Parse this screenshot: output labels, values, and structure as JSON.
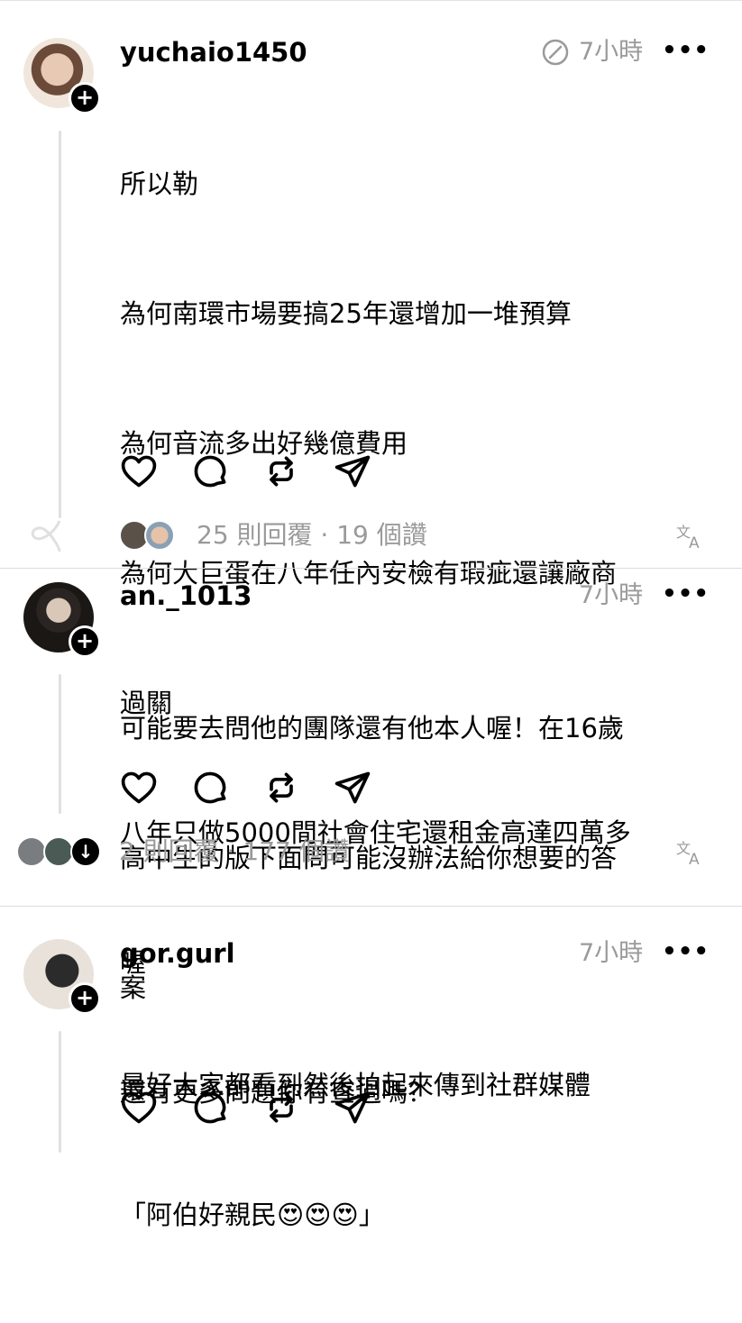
{
  "posts": [
    {
      "username": "yuchaio1450",
      "time": "7小時",
      "lines": [
        "所以勒",
        "為何南環市場要搞25年還增加一堆預算",
        "為何音流多出好幾億費用",
        "為何大巨蛋在八年任內安檢有瑕疵還讓廠商",
        "過關",
        "八年只做5000間社會住宅還租金高達四萬多",
        "喔",
        "還有更多問題你有查過嗎？"
      ],
      "stats": "25 則回覆 · 19 個讚"
    },
    {
      "username": "an._1013",
      "time": "7小時",
      "lines": [
        "可能要去問他的團隊還有他本人喔！在16歲",
        "高中生的版下面問可能沒辦法給你想要的答",
        "案"
      ],
      "stats": "2 則回覆 · 177 個讚"
    },
    {
      "username": "gor.gurl",
      "time": "7小時",
      "lines": [
        "最好大家都看到然後拍起來傳到社群媒體",
        "「阿伯好親民😍😍😍」"
      ]
    }
  ],
  "colors": {
    "muted": "#9a9a9a",
    "line": "#e0e0e0",
    "text": "#000000"
  }
}
